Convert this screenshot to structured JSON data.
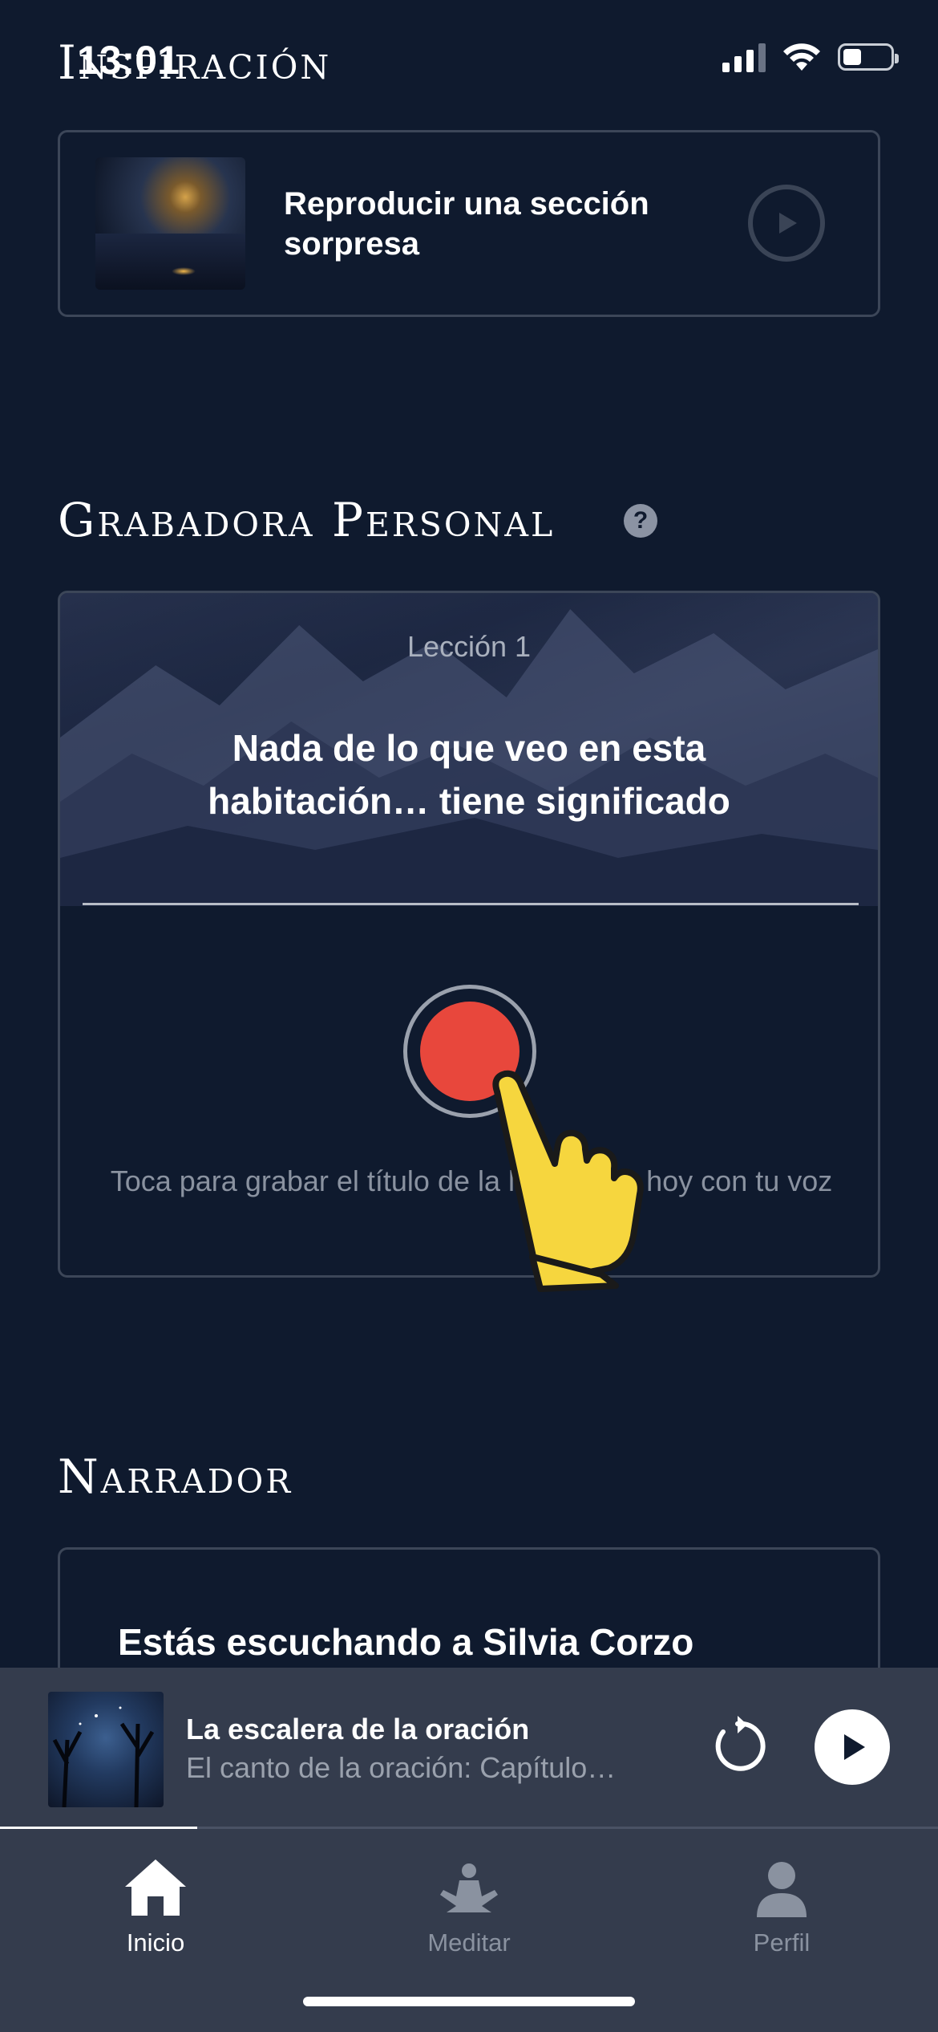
{
  "status_bar": {
    "time": "13:01",
    "overlay_title": "Inspiración",
    "battery_level": 0.3
  },
  "surprise": {
    "text": "Reproducir una sección sorpresa"
  },
  "recorder": {
    "section_title": "Grabadora Personal",
    "help_icon_label": "?",
    "lesson_number": "Lección 1",
    "lesson_title": "Nada de lo que veo en esta habitación… tiene significado",
    "hint": "Toca para grabar el título de la lección de hoy con tu voz"
  },
  "narrator": {
    "section_title": "Narrador",
    "text": "Estás escuchando a Silvia Corzo"
  },
  "mini_player": {
    "title": "La escalera de la oración",
    "subtitle": "El canto de la oración: Capítulo…",
    "progress": 0.21
  },
  "tabs": [
    {
      "label": "Inicio",
      "icon": "home-icon",
      "active": true
    },
    {
      "label": "Meditar",
      "icon": "meditate-icon",
      "active": false
    },
    {
      "label": "Perfil",
      "icon": "profile-icon",
      "active": false
    }
  ],
  "colors": {
    "background": "#0f1a2e",
    "record_red": "#e8473c",
    "bar": "#343c4d",
    "muted_text": "#8a92a0"
  }
}
